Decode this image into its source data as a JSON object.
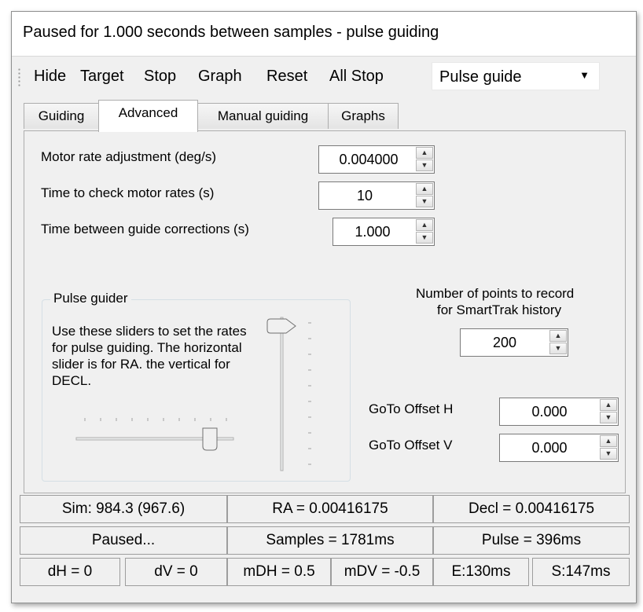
{
  "window": {
    "title": "Paused for 1.000 seconds between samples - pulse guiding"
  },
  "toolbar": {
    "hide": "Hide",
    "target": "Target",
    "stop": "Stop",
    "graph": "Graph",
    "reset": "Reset",
    "all_stop": "All Stop",
    "mode_selected": "Pulse guide"
  },
  "tabs": [
    {
      "label": "Guiding",
      "active": false
    },
    {
      "label": "Advanced",
      "active": true
    },
    {
      "label": "Manual guiding",
      "active": false
    },
    {
      "label": "Graphs",
      "active": false
    }
  ],
  "advanced": {
    "motor_rate_label": "Motor rate adjustment (deg/s)",
    "motor_rate_value": "0.004000",
    "check_rates_label": "Time to check motor rates (s)",
    "check_rates_value": "10",
    "between_corrections_label": "Time between guide corrections (s)",
    "between_corrections_value": "1.000",
    "pulse_guider": {
      "title": "Pulse guider",
      "description": "Use these sliders to set the rates for pulse guiding. The horizontal slider is for RA. the vertical for DECL.",
      "horizontal_slider_level": 1.0,
      "vertical_slider_level": 1.0
    },
    "points_label_line1": "Number of points to record",
    "points_label_line2": "for SmartTrak history",
    "points_value": "200",
    "goto_h_label": "GoTo Offset H",
    "goto_h_value": "0.000",
    "goto_v_label": "GoTo Offset V",
    "goto_v_value": "0.000"
  },
  "status": {
    "row1": [
      "Sim: 984.3 (967.6)",
      "RA = 0.00416175",
      "Decl = 0.00416175"
    ],
    "row2": [
      "Paused...",
      "Samples = 1781ms",
      "Pulse = 396ms"
    ],
    "row3": [
      "dH = 0",
      "dV = 0",
      "mDH = 0.5",
      "mDV = -0.5",
      "E:130ms",
      "S:147ms"
    ]
  }
}
